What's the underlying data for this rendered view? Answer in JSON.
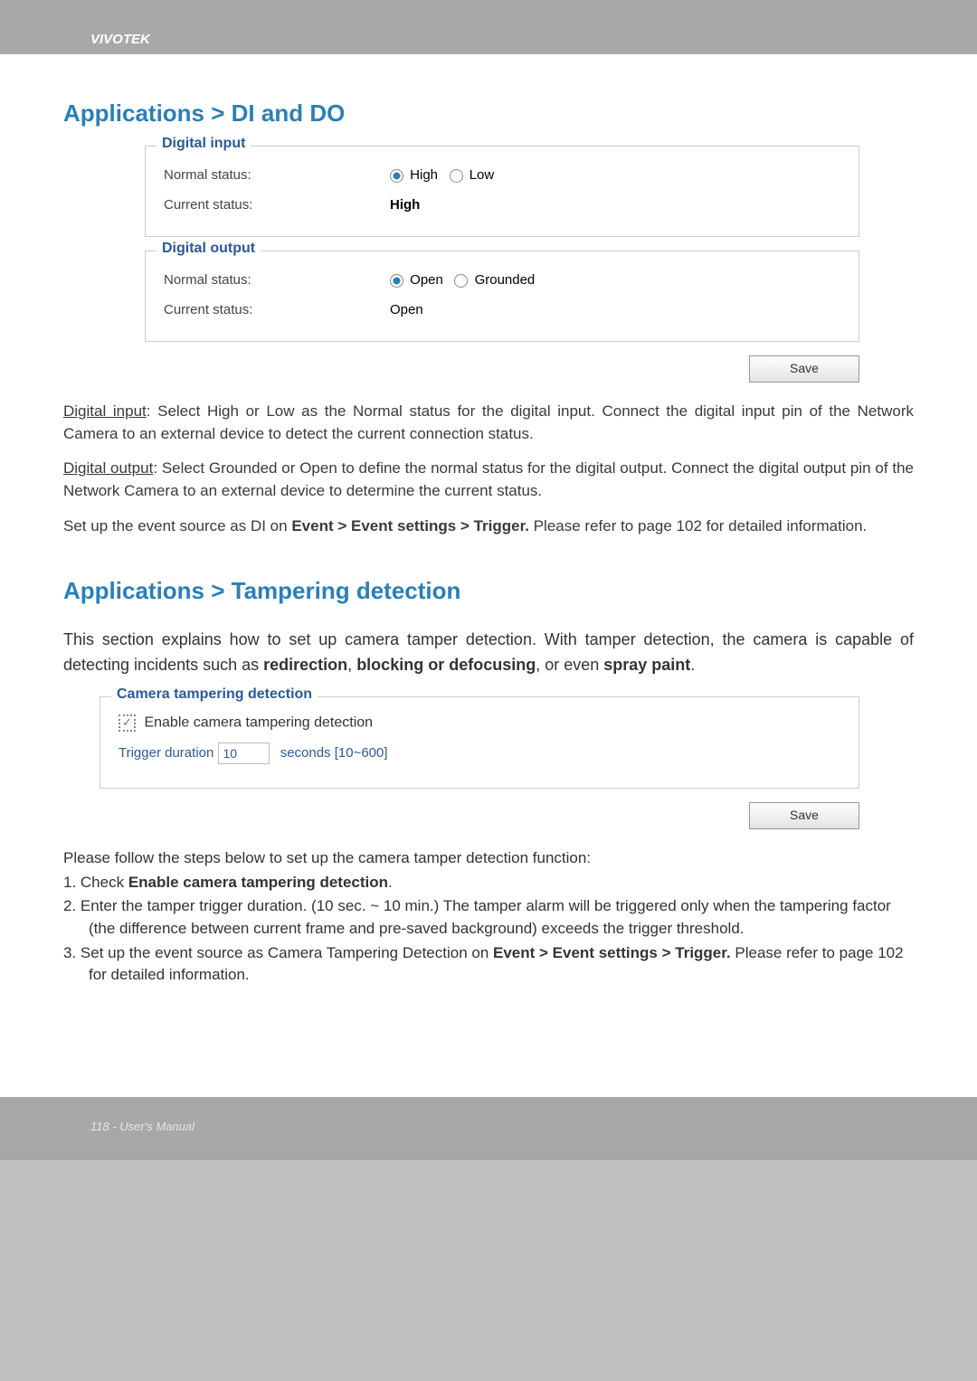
{
  "header": {
    "brand": "VIVOTEK"
  },
  "section1": {
    "title": "Applications > DI and DO",
    "digital_input": {
      "legend": "Digital input",
      "normal_label": "Normal status:",
      "radio_high": "High",
      "radio_low": "Low",
      "current_label": "Current status:",
      "current_value": "High"
    },
    "digital_output": {
      "legend": "Digital output",
      "normal_label": "Normal status:",
      "radio_open": "Open",
      "radio_grounded": "Grounded",
      "current_label": "Current status:",
      "current_value": "Open"
    },
    "save": "Save"
  },
  "para_di": {
    "u": "Digital input",
    "t": ": Select High or Low as the Normal status for the digital input. Connect the digital input pin of the Network Camera to an external device to detect the current connection status."
  },
  "para_do": {
    "u": "Digital output",
    "t": ": Select Grounded or Open to define the normal status for the digital output. Connect the digital output pin of the Network Camera to an external device to determine the current status."
  },
  "para_event": {
    "a": "Set up the event source as DI on ",
    "b": "Event > Event settings > Trigger.",
    "c": " Please refer to page 102 for detailed information."
  },
  "section2": {
    "title": "Applications > Tampering detection",
    "intro": {
      "a": "This section explains how to set up camera tamper detection. With tamper detection, the camera is capable of detecting incidents such as ",
      "b": "redirection",
      "c": ", ",
      "d": "blocking or defocusing",
      "e": ", or even ",
      "f": "spray paint",
      "g": "."
    },
    "tamper": {
      "legend": "Camera tampering detection",
      "enable": "Enable camera tampering detection",
      "trigger_label": "Trigger duration",
      "trigger_value": "10",
      "trigger_suffix": "seconds [10~600]"
    },
    "save": "Save",
    "steps_lead": "Please follow the steps below to set up the camera tamper detection function:",
    "step1_pre": "1. Check ",
    "step1_bold": "Enable camera tampering detection",
    "step1_post": ".",
    "step2": "2. Enter the tamper trigger duration. (10 sec. ~ 10 min.) The tamper alarm will be triggered only when the tampering factor (the difference between current frame and pre-saved background) exceeds the trigger threshold.",
    "step3_pre": "3. Set up the event source as Camera Tampering Detection on ",
    "step3_bold": "Event > Event settings > Trigger.",
    "step3_post": " Please refer to page 102 for detailed information."
  },
  "footer": {
    "text": "118 - User's Manual"
  }
}
